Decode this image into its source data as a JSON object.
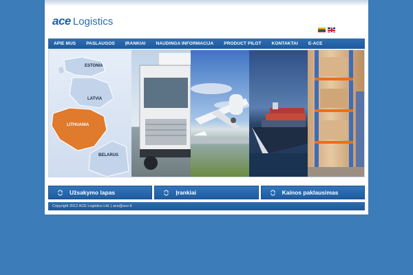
{
  "logo": {
    "brand": "ace",
    "suffix": "Logistics"
  },
  "languages": [
    {
      "code": "lt",
      "icon": "lithuania-flag-icon"
    },
    {
      "code": "en",
      "icon": "uk-flag-icon"
    }
  ],
  "nav": {
    "items": [
      {
        "label": "APIE MUS"
      },
      {
        "label": "PASLAUGOS"
      },
      {
        "label": "ĮRANKIAI"
      },
      {
        "label": "NAUDINGA INFORMACIJA"
      },
      {
        "label": "PRODUCT PILOT"
      },
      {
        "label": "KONTAKTAI"
      },
      {
        "label": "E-ACE"
      }
    ]
  },
  "banner": {
    "map_labels": {
      "estonia": "ESTONIA",
      "latvia": "LATVIA",
      "lithuania": "LITHUANIA",
      "belarus": "BELARUS"
    }
  },
  "tabs": [
    {
      "label": "Užsakymo lapas",
      "icon": "refresh-icon"
    },
    {
      "label": "Įrankiai",
      "icon": "refresh-icon"
    },
    {
      "label": "Kainos paklausimas",
      "icon": "refresh-icon"
    }
  ],
  "footer": {
    "copyright": "Copyright 2012 ACE Logistics Ltd. | ace@ace.lt"
  },
  "colors": {
    "background": "#3c7cb8",
    "nav": "#1d5a9c",
    "lithuania_highlight": "#e07a2c",
    "logo": "#1b5fa8"
  }
}
